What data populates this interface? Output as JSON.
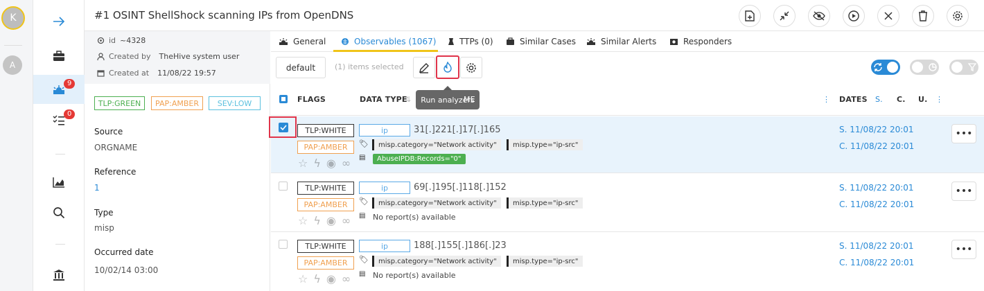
{
  "rail": {
    "user_initial": "K",
    "org_initial": "A"
  },
  "nav": {
    "alerts_badge": "9",
    "tasks_badge": "0"
  },
  "header": {
    "title": "#1 OSINT ShellShock scanning IPs from OpenDNS"
  },
  "case": {
    "id_label": "id",
    "id_value": "~4328",
    "created_by_label": "Created by",
    "created_by_value": "TheHive system user",
    "created_at_label": "Created at",
    "created_at_value": "11/08/22 19:57",
    "tags": [
      "TLP:GREEN",
      "PAP:AMBER",
      "SEV:LOW"
    ],
    "source_label": "Source",
    "source_value": "ORGNAME",
    "reference_label": "Reference",
    "reference_value": "1",
    "type_label": "Type",
    "type_value": "misp",
    "occurred_label": "Occurred date",
    "occurred_value": "10/02/14 03:00"
  },
  "tabs": [
    {
      "label": "General"
    },
    {
      "label": "Observables (1067)"
    },
    {
      "label": "TTPs (0)"
    },
    {
      "label": "Similar Cases"
    },
    {
      "label": "Similar Alerts"
    },
    {
      "label": "Responders"
    }
  ],
  "toolbar": {
    "default_label": "default",
    "selected_text": "(1) items selected",
    "tooltip": "Run analyzers"
  },
  "table": {
    "headers": {
      "flags": "FLAGS",
      "data_type": "DATA TYPE",
      "name_tail": "ME",
      "dates": "DATES",
      "s": "S.",
      "c": "C.",
      "u": "U."
    },
    "rows": [
      {
        "tlp": "TLP:WHITE",
        "pap": "PAP:AMBER",
        "type": "ip",
        "value": "31[.]221[.]17[.]165",
        "tag1": "misp.category=\"Network activity\"",
        "tag2": "misp.type=\"ip-src\"",
        "report": "AbuseIPDB:Records=\"0\"",
        "date_s": "S. 11/08/22 20:01",
        "date_c": "C. 11/08/22 20:01",
        "selected": true
      },
      {
        "tlp": "TLP:WHITE",
        "pap": "PAP:AMBER",
        "type": "ip",
        "value": "69[.]195[.]118[.]152",
        "tag1": "misp.category=\"Network activity\"",
        "tag2": "misp.type=\"ip-src\"",
        "report": "No report(s) available",
        "date_s": "S. 11/08/22 20:01",
        "date_c": "C. 11/08/22 20:01",
        "selected": false
      },
      {
        "tlp": "TLP:WHITE",
        "pap": "PAP:AMBER",
        "type": "ip",
        "value": "188[.]155[.]186[.]23",
        "tag1": "misp.category=\"Network activity\"",
        "tag2": "misp.type=\"ip-src\"",
        "report": "No report(s) available",
        "date_s": "S. 11/08/22 20:01",
        "date_c": "C. 11/08/22 20:01",
        "selected": false
      }
    ],
    "more_label": "•••"
  },
  "colors": {
    "accent": "#2a8ad6",
    "highlight": "#e0344a",
    "tab_underline": "#f0c419",
    "tlp_green": "#4caf50",
    "pap_amber": "#f0a050",
    "tlp_clear": "#5bc0de"
  }
}
